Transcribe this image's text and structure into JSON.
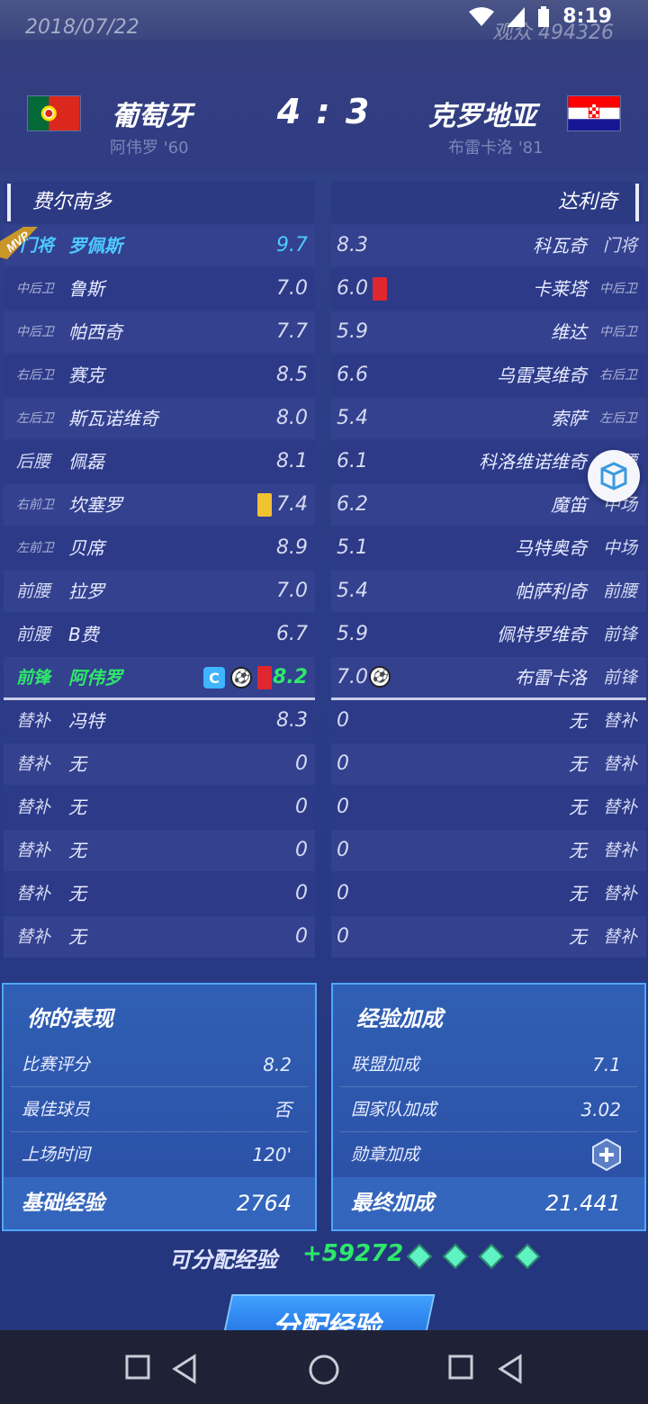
{
  "status_bar": {
    "date": "2018/07/22",
    "views": "观众 494326",
    "time": "8:19"
  },
  "match": {
    "home": {
      "name": "葡萄牙",
      "scorer": "阿伟罗 '60"
    },
    "away": {
      "name": "克罗地亚",
      "scorer": "布雷卡洛 '81"
    },
    "score": "4 : 3"
  },
  "coaches": {
    "home": "费尔南多",
    "away": "达利奇"
  },
  "home_players": [
    {
      "pos": "门将",
      "name": "罗佩斯",
      "rating": "9.7"
    },
    {
      "pos": "中后卫",
      "name": "鲁斯",
      "rating": "7.0"
    },
    {
      "pos": "中后卫",
      "name": "帕西奇",
      "rating": "7.7"
    },
    {
      "pos": "右后卫",
      "name": "赛克",
      "rating": "8.5"
    },
    {
      "pos": "左后卫",
      "name": "斯瓦诺维奇",
      "rating": "8.0"
    },
    {
      "pos": "后腰",
      "name": "佩磊",
      "rating": "8.1"
    },
    {
      "pos": "右前卫",
      "name": "坎塞罗",
      "rating": "7.4"
    },
    {
      "pos": "左前卫",
      "name": "贝席",
      "rating": "8.9"
    },
    {
      "pos": "前腰",
      "name": "拉罗",
      "rating": "7.0"
    },
    {
      "pos": "前腰",
      "name": "B费",
      "rating": "6.7"
    },
    {
      "pos": "前锋",
      "name": "阿伟罗",
      "rating": "8.2",
      "captain": "C"
    },
    {
      "pos": "替补",
      "name": "冯特",
      "rating": "8.3"
    },
    {
      "pos": "替补",
      "name": "无",
      "rating": "0"
    },
    {
      "pos": "替补",
      "name": "无",
      "rating": "0"
    },
    {
      "pos": "替补",
      "name": "无",
      "rating": "0"
    },
    {
      "pos": "替补",
      "name": "无",
      "rating": "0"
    },
    {
      "pos": "替补",
      "name": "无",
      "rating": "0"
    }
  ],
  "away_players": [
    {
      "pos": "门将",
      "name": "科瓦奇",
      "rating": "8.3"
    },
    {
      "pos": "中后卫",
      "name": "卡莱塔",
      "rating": "6.0"
    },
    {
      "pos": "中后卫",
      "name": "维达",
      "rating": "5.9"
    },
    {
      "pos": "右后卫",
      "name": "乌雷莫维奇",
      "rating": "6.6"
    },
    {
      "pos": "左后卫",
      "name": "索萨",
      "rating": "5.4"
    },
    {
      "pos": "后腰",
      "name": "科洛维诺维奇",
      "rating": "6.1"
    },
    {
      "pos": "中场",
      "name": "魔笛",
      "rating": "6.2"
    },
    {
      "pos": "中场",
      "name": "马特奥奇",
      "rating": "5.1"
    },
    {
      "pos": "前腰",
      "name": "帕萨利奇",
      "rating": "5.4"
    },
    {
      "pos": "前锋",
      "name": "佩特罗维奇",
      "rating": "5.9"
    },
    {
      "pos": "前锋",
      "name": "布雷卡洛",
      "rating": "7.0"
    },
    {
      "pos": "替补",
      "name": "无",
      "rating": "0"
    },
    {
      "pos": "替补",
      "name": "无",
      "rating": "0"
    },
    {
      "pos": "替补",
      "name": "无",
      "rating": "0"
    },
    {
      "pos": "替补",
      "name": "无",
      "rating": "0"
    },
    {
      "pos": "替补",
      "name": "无",
      "rating": "0"
    },
    {
      "pos": "替补",
      "name": "无",
      "rating": "0"
    }
  ],
  "performance": {
    "title": "你的表现",
    "rows": [
      {
        "label": "比赛评分",
        "value": "8.2"
      },
      {
        "label": "最佳球员",
        "value": "否"
      },
      {
        "label": "上场时间",
        "value": "120'"
      }
    ],
    "footer": {
      "label": "基础经验",
      "value": "2764"
    }
  },
  "bonus": {
    "title": "经验加成",
    "rows": [
      {
        "label": "联盟加成",
        "value": "7.1"
      },
      {
        "label": "国家队加成",
        "value": "3.02"
      },
      {
        "label": "勋章加成",
        "value": ""
      }
    ],
    "footer": {
      "label": "最终加成",
      "value": "21.441"
    }
  },
  "distributable": {
    "label": "可分配经验",
    "value": "+59272"
  },
  "button": {
    "label": "分配经验"
  },
  "mvp_badge": "MVP",
  "colors": {
    "accent_blue": "#4ec9ff",
    "highlight_green": "#2ee86a",
    "panel_border": "#4fa7ff"
  }
}
